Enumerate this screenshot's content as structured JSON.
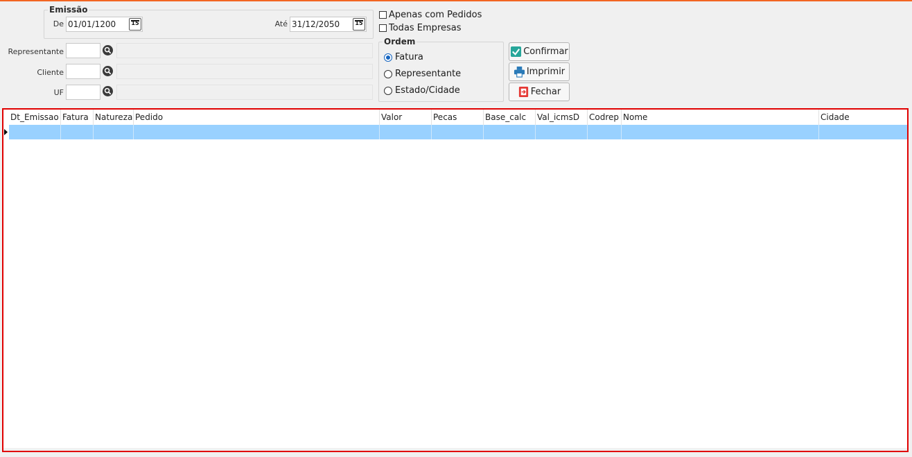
{
  "emissao": {
    "legend": "Emissão",
    "from_label": "De",
    "from_value": "01/01/1200",
    "to_label": "Até",
    "to_value": "31/12/2050",
    "calendar_glyph": "15"
  },
  "filters": {
    "representante_label": "Representante",
    "cliente_label": "Cliente",
    "uf_label": "UF"
  },
  "checks": {
    "apenas_label": "Apenas com Pedidos",
    "todas_label": "Todas Empresas"
  },
  "ordem": {
    "legend": "Ordem",
    "options": [
      "Fatura",
      "Representante",
      "Estado/Cidade"
    ],
    "selected": "Fatura"
  },
  "buttons": {
    "confirmar": "Confirmar",
    "imprimir": "Imprimir",
    "fechar": "Fechar"
  },
  "grid": {
    "columns": [
      "Dt_Emissao",
      "Fatura",
      "Natureza",
      "Pedido",
      "Valor",
      "Pecas",
      "Base_calc",
      "Val_icmsD",
      "Codrep",
      "Nome",
      "Cidade"
    ]
  },
  "colors": {
    "accent": "#f26522",
    "selection": "#99d1ff",
    "grid_border": "#e00000",
    "radio_selected": "#1565c0"
  }
}
